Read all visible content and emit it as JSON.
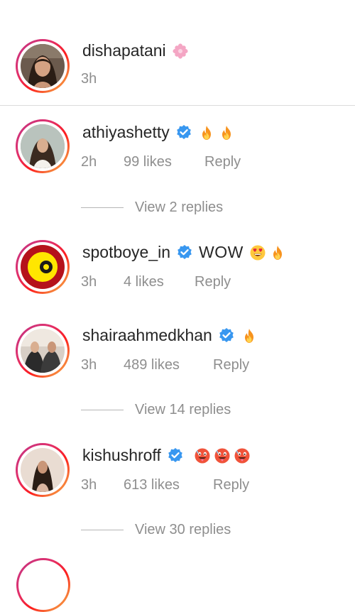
{
  "header_comment": {
    "username": "dishapatani",
    "emoji": "flower-emoji",
    "time": "3h"
  },
  "comments": [
    {
      "username": "athiyashetty",
      "verified": true,
      "emojis": [
        "fire-emoji",
        "fire-emoji"
      ],
      "text": "",
      "time": "2h",
      "likes": "99 likes",
      "reply": "Reply",
      "view_replies": "View 2 replies"
    },
    {
      "username": "spotboye_in",
      "verified": true,
      "text": "WOW",
      "emojis": [
        "heart-eyes-emoji",
        "fire-emoji"
      ],
      "time": "3h",
      "likes": "4 likes",
      "reply": "Reply",
      "view_replies": ""
    },
    {
      "username": "shairaahmedkhan",
      "verified": true,
      "text": "",
      "emojis": [
        "fire-emoji"
      ],
      "time": "3h",
      "likes": "489 likes",
      "reply": "Reply",
      "view_replies": "View 14 replies"
    },
    {
      "username": "kishushroff",
      "verified": true,
      "text": "",
      "emojis": [
        "hot-face-emoji",
        "hot-face-emoji",
        "hot-face-emoji"
      ],
      "time": "3h",
      "likes": "613 likes",
      "reply": "Reply",
      "view_replies": "View 30 replies"
    }
  ],
  "colors": {
    "verified_blue": "#3897f0",
    "meta_gray": "#8e8e8e",
    "text": "#262626"
  }
}
